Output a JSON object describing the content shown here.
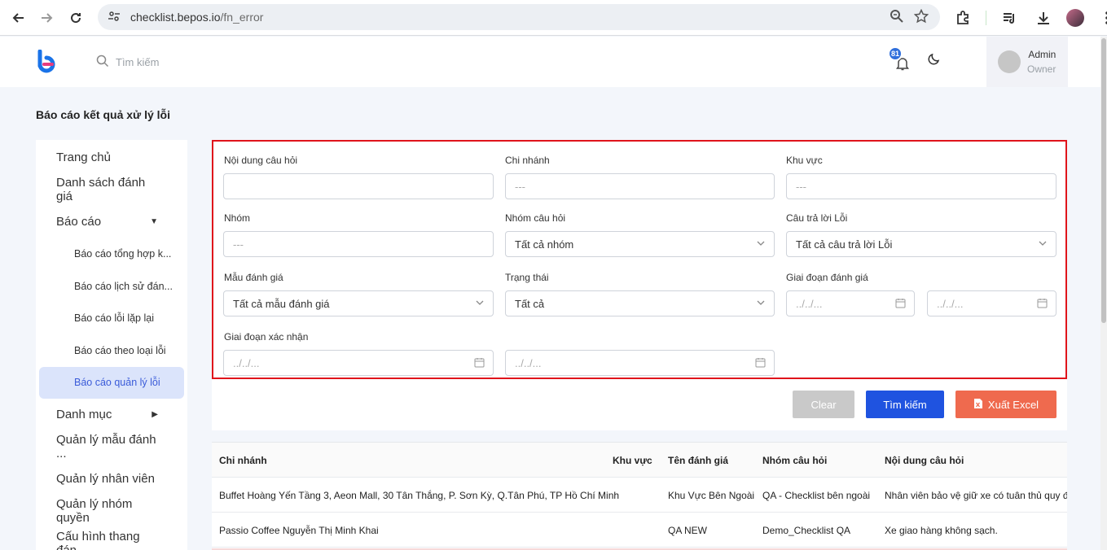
{
  "browser": {
    "url_host": "checklist.bepos.io",
    "url_path": "/fn_error"
  },
  "header": {
    "search_placeholder": "Tìm kiếm",
    "notification_count": "81",
    "user_name": "Admin",
    "user_role": "Owner"
  },
  "page": {
    "title": "Báo cáo kết quả xử lý lỗi"
  },
  "sidebar": {
    "items": [
      {
        "label": "Trang chủ"
      },
      {
        "label": "Danh sách đánh giá"
      },
      {
        "label": "Báo cáo"
      },
      {
        "label": "Danh mục"
      },
      {
        "label": "Quản lý mẫu đánh ..."
      },
      {
        "label": "Quản lý nhân viên"
      },
      {
        "label": "Quản lý nhóm quyền"
      },
      {
        "label": "Cấu hình thang đán..."
      }
    ],
    "sub_items": [
      {
        "label": "Báo cáo tổng hợp k..."
      },
      {
        "label": "Báo cáo lịch sử đán..."
      },
      {
        "label": "Báo cáo lỗi lặp lại"
      },
      {
        "label": "Báo cáo theo loại lỗi"
      },
      {
        "label": "Báo cáo quản lý lỗi"
      }
    ]
  },
  "filters": {
    "question_content": {
      "label": "Nội dung câu hỏi",
      "value": ""
    },
    "branch": {
      "label": "Chi nhánh",
      "placeholder": "---"
    },
    "region": {
      "label": "Khu vực",
      "placeholder": "---"
    },
    "group": {
      "label": "Nhóm",
      "placeholder": "---"
    },
    "question_group": {
      "label": "Nhóm câu hỏi",
      "value": "Tất cả nhóm"
    },
    "error_answer": {
      "label": "Câu trả lời Lỗi",
      "value": "Tất cả câu trả lời Lỗi"
    },
    "template": {
      "label": "Mẫu đánh giá",
      "value": "Tất cả mẫu đánh giá"
    },
    "status": {
      "label": "Trạng thái",
      "value": "Tất cả"
    },
    "eval_period": {
      "label": "Giai đoạn đánh giá",
      "from": "../../...",
      "to": "../../..."
    },
    "confirm_period": {
      "label": "Giai đoạn xác nhận",
      "from": "../../...",
      "to": "../../..."
    }
  },
  "actions": {
    "clear": "Clear",
    "search": "Tìm kiếm",
    "export": "Xuất Excel"
  },
  "table": {
    "columns": [
      "Chi nhánh",
      "Khu vực",
      "Tên đánh giá",
      "Nhóm câu hỏi",
      "Nội dung câu hỏi"
    ],
    "rows": [
      [
        "Buffet Hoàng Yến Tầng 3, Aeon Mall, 30 Tân Thắng, P. Sơn Kỳ, Q.Tân Phú, TP Hồ Chí Minh",
        "",
        "Khu Vực Bên Ngoài",
        "QA - Checklist bên ngoài",
        "Nhân viên bảo vệ giữ xe có tuân thủ quy định"
      ],
      [
        "Passio Coffee Nguyễn Thị Minh Khai",
        "",
        "QA NEW",
        "Demo_Checklist QA",
        "Xe giao hàng không sạch."
      ]
    ]
  }
}
